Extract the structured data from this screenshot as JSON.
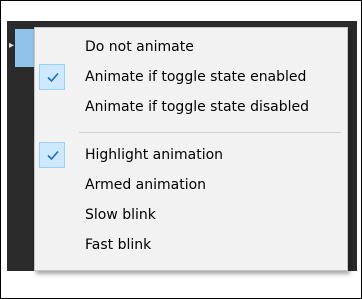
{
  "context_menu": {
    "groups": [
      {
        "items": [
          {
            "label": "Do not animate",
            "checked": false
          },
          {
            "label": "Animate if toggle state enabled",
            "checked": true
          },
          {
            "label": "Animate if toggle state disabled",
            "checked": false
          }
        ]
      },
      {
        "items": [
          {
            "label": "Highlight animation",
            "checked": true
          },
          {
            "label": "Armed animation",
            "checked": false
          },
          {
            "label": "Slow blink",
            "checked": false
          },
          {
            "label": "Fast blink",
            "checked": false
          }
        ]
      }
    ]
  },
  "icons": {
    "check": "check-icon",
    "submenu_arrow": "chevron-right-icon"
  },
  "colors": {
    "menu_background": "#f2f2f2",
    "check_highlight": "#cde8ff",
    "check_mark": "#1c6fb8",
    "behind_panel": "#2b2b2b",
    "behind_selection": "#8fc3ea"
  }
}
